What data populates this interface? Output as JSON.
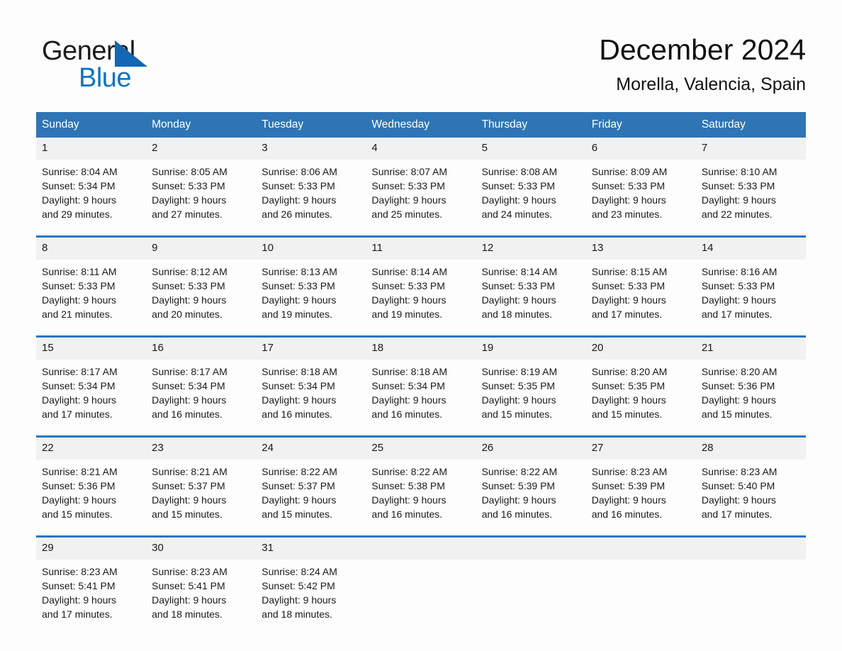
{
  "brand": {
    "name_part1": "General",
    "name_part2": "Blue",
    "triangle_color": "#1268b3",
    "blue_text_color": "#0f73c4"
  },
  "header": {
    "title": "December 2024",
    "location": "Morella, Valencia, Spain"
  },
  "theme": {
    "header_row_bg": "#2e75b6",
    "header_row_text": "#ffffff",
    "daynum_band_bg": "#f1f1f1",
    "row_separator": "#2e75b6",
    "page_bg": "#fdfdfd"
  },
  "weekdays": [
    "Sunday",
    "Monday",
    "Tuesday",
    "Wednesday",
    "Thursday",
    "Friday",
    "Saturday"
  ],
  "weeks": [
    [
      {
        "day": "1",
        "sunrise": "Sunrise: 8:04 AM",
        "sunset": "Sunset: 5:34 PM",
        "daylight_line1": "Daylight: 9 hours",
        "daylight_line2": "and 29 minutes."
      },
      {
        "day": "2",
        "sunrise": "Sunrise: 8:05 AM",
        "sunset": "Sunset: 5:33 PM",
        "daylight_line1": "Daylight: 9 hours",
        "daylight_line2": "and 27 minutes."
      },
      {
        "day": "3",
        "sunrise": "Sunrise: 8:06 AM",
        "sunset": "Sunset: 5:33 PM",
        "daylight_line1": "Daylight: 9 hours",
        "daylight_line2": "and 26 minutes."
      },
      {
        "day": "4",
        "sunrise": "Sunrise: 8:07 AM",
        "sunset": "Sunset: 5:33 PM",
        "daylight_line1": "Daylight: 9 hours",
        "daylight_line2": "and 25 minutes."
      },
      {
        "day": "5",
        "sunrise": "Sunrise: 8:08 AM",
        "sunset": "Sunset: 5:33 PM",
        "daylight_line1": "Daylight: 9 hours",
        "daylight_line2": "and 24 minutes."
      },
      {
        "day": "6",
        "sunrise": "Sunrise: 8:09 AM",
        "sunset": "Sunset: 5:33 PM",
        "daylight_line1": "Daylight: 9 hours",
        "daylight_line2": "and 23 minutes."
      },
      {
        "day": "7",
        "sunrise": "Sunrise: 8:10 AM",
        "sunset": "Sunset: 5:33 PM",
        "daylight_line1": "Daylight: 9 hours",
        "daylight_line2": "and 22 minutes."
      }
    ],
    [
      {
        "day": "8",
        "sunrise": "Sunrise: 8:11 AM",
        "sunset": "Sunset: 5:33 PM",
        "daylight_line1": "Daylight: 9 hours",
        "daylight_line2": "and 21 minutes."
      },
      {
        "day": "9",
        "sunrise": "Sunrise: 8:12 AM",
        "sunset": "Sunset: 5:33 PM",
        "daylight_line1": "Daylight: 9 hours",
        "daylight_line2": "and 20 minutes."
      },
      {
        "day": "10",
        "sunrise": "Sunrise: 8:13 AM",
        "sunset": "Sunset: 5:33 PM",
        "daylight_line1": "Daylight: 9 hours",
        "daylight_line2": "and 19 minutes."
      },
      {
        "day": "11",
        "sunrise": "Sunrise: 8:14 AM",
        "sunset": "Sunset: 5:33 PM",
        "daylight_line1": "Daylight: 9 hours",
        "daylight_line2": "and 19 minutes."
      },
      {
        "day": "12",
        "sunrise": "Sunrise: 8:14 AM",
        "sunset": "Sunset: 5:33 PM",
        "daylight_line1": "Daylight: 9 hours",
        "daylight_line2": "and 18 minutes."
      },
      {
        "day": "13",
        "sunrise": "Sunrise: 8:15 AM",
        "sunset": "Sunset: 5:33 PM",
        "daylight_line1": "Daylight: 9 hours",
        "daylight_line2": "and 17 minutes."
      },
      {
        "day": "14",
        "sunrise": "Sunrise: 8:16 AM",
        "sunset": "Sunset: 5:33 PM",
        "daylight_line1": "Daylight: 9 hours",
        "daylight_line2": "and 17 minutes."
      }
    ],
    [
      {
        "day": "15",
        "sunrise": "Sunrise: 8:17 AM",
        "sunset": "Sunset: 5:34 PM",
        "daylight_line1": "Daylight: 9 hours",
        "daylight_line2": "and 17 minutes."
      },
      {
        "day": "16",
        "sunrise": "Sunrise: 8:17 AM",
        "sunset": "Sunset: 5:34 PM",
        "daylight_line1": "Daylight: 9 hours",
        "daylight_line2": "and 16 minutes."
      },
      {
        "day": "17",
        "sunrise": "Sunrise: 8:18 AM",
        "sunset": "Sunset: 5:34 PM",
        "daylight_line1": "Daylight: 9 hours",
        "daylight_line2": "and 16 minutes."
      },
      {
        "day": "18",
        "sunrise": "Sunrise: 8:18 AM",
        "sunset": "Sunset: 5:34 PM",
        "daylight_line1": "Daylight: 9 hours",
        "daylight_line2": "and 16 minutes."
      },
      {
        "day": "19",
        "sunrise": "Sunrise: 8:19 AM",
        "sunset": "Sunset: 5:35 PM",
        "daylight_line1": "Daylight: 9 hours",
        "daylight_line2": "and 15 minutes."
      },
      {
        "day": "20",
        "sunrise": "Sunrise: 8:20 AM",
        "sunset": "Sunset: 5:35 PM",
        "daylight_line1": "Daylight: 9 hours",
        "daylight_line2": "and 15 minutes."
      },
      {
        "day": "21",
        "sunrise": "Sunrise: 8:20 AM",
        "sunset": "Sunset: 5:36 PM",
        "daylight_line1": "Daylight: 9 hours",
        "daylight_line2": "and 15 minutes."
      }
    ],
    [
      {
        "day": "22",
        "sunrise": "Sunrise: 8:21 AM",
        "sunset": "Sunset: 5:36 PM",
        "daylight_line1": "Daylight: 9 hours",
        "daylight_line2": "and 15 minutes."
      },
      {
        "day": "23",
        "sunrise": "Sunrise: 8:21 AM",
        "sunset": "Sunset: 5:37 PM",
        "daylight_line1": "Daylight: 9 hours",
        "daylight_line2": "and 15 minutes."
      },
      {
        "day": "24",
        "sunrise": "Sunrise: 8:22 AM",
        "sunset": "Sunset: 5:37 PM",
        "daylight_line1": "Daylight: 9 hours",
        "daylight_line2": "and 15 minutes."
      },
      {
        "day": "25",
        "sunrise": "Sunrise: 8:22 AM",
        "sunset": "Sunset: 5:38 PM",
        "daylight_line1": "Daylight: 9 hours",
        "daylight_line2": "and 16 minutes."
      },
      {
        "day": "26",
        "sunrise": "Sunrise: 8:22 AM",
        "sunset": "Sunset: 5:39 PM",
        "daylight_line1": "Daylight: 9 hours",
        "daylight_line2": "and 16 minutes."
      },
      {
        "day": "27",
        "sunrise": "Sunrise: 8:23 AM",
        "sunset": "Sunset: 5:39 PM",
        "daylight_line1": "Daylight: 9 hours",
        "daylight_line2": "and 16 minutes."
      },
      {
        "day": "28",
        "sunrise": "Sunrise: 8:23 AM",
        "sunset": "Sunset: 5:40 PM",
        "daylight_line1": "Daylight: 9 hours",
        "daylight_line2": "and 17 minutes."
      }
    ],
    [
      {
        "day": "29",
        "sunrise": "Sunrise: 8:23 AM",
        "sunset": "Sunset: 5:41 PM",
        "daylight_line1": "Daylight: 9 hours",
        "daylight_line2": "and 17 minutes."
      },
      {
        "day": "30",
        "sunrise": "Sunrise: 8:23 AM",
        "sunset": "Sunset: 5:41 PM",
        "daylight_line1": "Daylight: 9 hours",
        "daylight_line2": "and 18 minutes."
      },
      {
        "day": "31",
        "sunrise": "Sunrise: 8:24 AM",
        "sunset": "Sunset: 5:42 PM",
        "daylight_line1": "Daylight: 9 hours",
        "daylight_line2": "and 18 minutes."
      },
      {
        "day": "",
        "sunrise": "",
        "sunset": "",
        "daylight_line1": "",
        "daylight_line2": ""
      },
      {
        "day": "",
        "sunrise": "",
        "sunset": "",
        "daylight_line1": "",
        "daylight_line2": ""
      },
      {
        "day": "",
        "sunrise": "",
        "sunset": "",
        "daylight_line1": "",
        "daylight_line2": ""
      },
      {
        "day": "",
        "sunrise": "",
        "sunset": "",
        "daylight_line1": "",
        "daylight_line2": ""
      }
    ]
  ]
}
